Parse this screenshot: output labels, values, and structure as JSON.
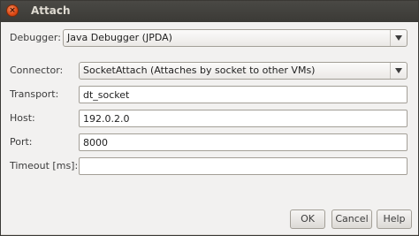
{
  "window": {
    "title": "Attach",
    "close_glyph": "×"
  },
  "form": {
    "debugger": {
      "label": "Debugger:",
      "value": "Java Debugger (JPDA)"
    },
    "connector": {
      "label": "Connector:",
      "value": "SocketAttach (Attaches by socket to other VMs)"
    },
    "transport": {
      "label": "Transport:",
      "value": "dt_socket"
    },
    "host": {
      "label": "Host:",
      "value": "192.0.2.0"
    },
    "port": {
      "label": "Port:",
      "value": "8000"
    },
    "timeout": {
      "label": "Timeout [ms]:",
      "value": ""
    }
  },
  "buttons": {
    "ok": "OK",
    "cancel": "Cancel",
    "help": "Help"
  },
  "colors": {
    "titlebar": "#3c3b37",
    "close_button": "#dd4814",
    "dialog_bg": "#f2f1f0"
  },
  "icons": {
    "close": "close-icon",
    "dropdown": "chevron-down-icon"
  }
}
